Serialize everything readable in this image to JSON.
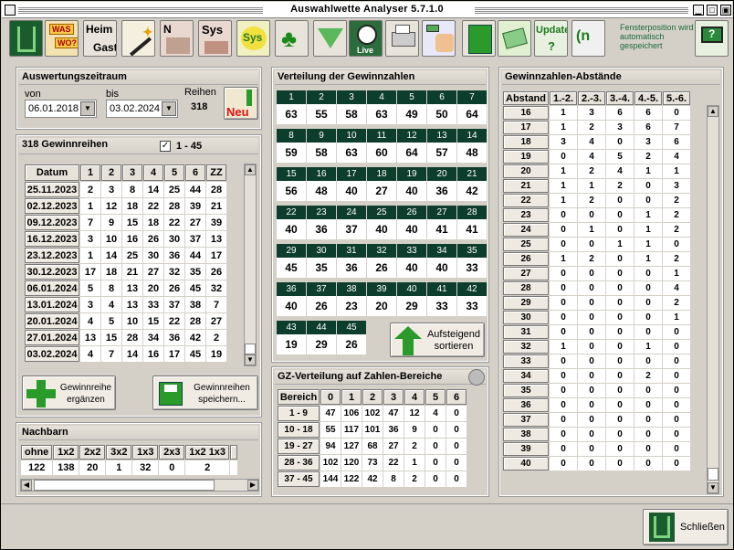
{
  "window": {
    "title": "Auswahlwette Analyser 5.7.1.0"
  },
  "toolbar": {
    "icons": [
      "app-logo-icon",
      "was-wo-icon",
      "heim-gast-icon",
      "magic-wand-icon",
      "n-chart-icon",
      "sys-icon",
      "sys-lamp-icon",
      "clover-icon",
      "funnel-icon",
      "live-ball-icon",
      "printer-icon",
      "hand-calculator-icon",
      "spreadsheet-icon",
      "tips-icon",
      "update-icon",
      "nk-icon",
      "help-computer-icon"
    ],
    "heim": "Heim",
    "gast": "Gast",
    "was": "WAS",
    "wo": "WO?",
    "n": "N",
    "sys": "Sys",
    "sys2": "Sys",
    "live": "Live",
    "update": "Update",
    "note": "Fensterposition wird automatisch gespeichert"
  },
  "zeitraum": {
    "title": "Auswertungszeitraum",
    "von_label": "von",
    "bis_label": "bis",
    "reihen_label": "Reihen",
    "von": "06.01.2018",
    "bis": "03.02.2024",
    "reihen": "318",
    "neu": "Neu"
  },
  "gewinnreihen": {
    "title": "318 Gewinnreihen",
    "filter": "1 - 45",
    "headers": [
      "Datum",
      "1",
      "2",
      "3",
      "4",
      "5",
      "6",
      "ZZ"
    ],
    "rows": [
      [
        "25.11.2023",
        "2",
        "3",
        "8",
        "14",
        "25",
        "44",
        "28"
      ],
      [
        "02.12.2023",
        "1",
        "12",
        "18",
        "22",
        "28",
        "39",
        "21"
      ],
      [
        "09.12.2023",
        "7",
        "9",
        "15",
        "18",
        "22",
        "27",
        "39"
      ],
      [
        "16.12.2023",
        "3",
        "10",
        "16",
        "26",
        "30",
        "37",
        "13"
      ],
      [
        "23.12.2023",
        "1",
        "14",
        "25",
        "30",
        "36",
        "44",
        "17"
      ],
      [
        "30.12.2023",
        "17",
        "18",
        "21",
        "27",
        "32",
        "35",
        "26"
      ],
      [
        "06.01.2024",
        "5",
        "8",
        "13",
        "20",
        "26",
        "45",
        "32"
      ],
      [
        "13.01.2024",
        "3",
        "4",
        "13",
        "33",
        "37",
        "38",
        "7"
      ],
      [
        "20.01.2024",
        "4",
        "5",
        "10",
        "15",
        "22",
        "28",
        "27"
      ],
      [
        "27.01.2024",
        "13",
        "15",
        "28",
        "34",
        "36",
        "42",
        "2"
      ],
      [
        "03.02.2024",
        "4",
        "7",
        "14",
        "16",
        "17",
        "45",
        "19"
      ]
    ],
    "add_btn": "Gewinnreihe ergänzen",
    "save_btn": "Gewinnreihen speichern..."
  },
  "nachbarn": {
    "title": "Nachbarn",
    "headers": [
      "ohne",
      "1x2",
      "2x2",
      "3x2",
      "1x3",
      "2x3",
      "1x2 1x3",
      ""
    ],
    "values": [
      "122",
      "138",
      "20",
      "1",
      "32",
      "0",
      "2",
      ""
    ]
  },
  "verteilung": {
    "title": "Verteilung der Gewinnzahlen",
    "counts": [
      "63",
      "55",
      "58",
      "63",
      "49",
      "50",
      "64",
      "59",
      "58",
      "63",
      "60",
      "64",
      "57",
      "48",
      "56",
      "48",
      "40",
      "27",
      "40",
      "36",
      "42",
      "40",
      "36",
      "37",
      "40",
      "40",
      "41",
      "41",
      "45",
      "35",
      "36",
      "26",
      "40",
      "40",
      "33",
      "40",
      "26",
      "23",
      "20",
      "29",
      "33",
      "33",
      "19",
      "29",
      "26"
    ],
    "sort_btn": "Aufsteigend sortieren"
  },
  "bereich": {
    "title": "GZ-Verteilung auf Zahlen-Bereiche",
    "headers": [
      "Bereich",
      "0",
      "1",
      "2",
      "3",
      "4",
      "5",
      "6"
    ],
    "rows": [
      [
        "1 - 9",
        "47",
        "106",
        "102",
        "47",
        "12",
        "4",
        "0"
      ],
      [
        "10 - 18",
        "55",
        "117",
        "101",
        "36",
        "9",
        "0",
        "0"
      ],
      [
        "19 - 27",
        "94",
        "127",
        "68",
        "27",
        "2",
        "0",
        "0"
      ],
      [
        "28 - 36",
        "102",
        "120",
        "73",
        "22",
        "1",
        "0",
        "0"
      ],
      [
        "37 - 45",
        "144",
        "122",
        "42",
        "8",
        "2",
        "0",
        "0"
      ]
    ]
  },
  "abstaende": {
    "title": "Gewinnzahlen-Abstände",
    "headers": [
      "Abstand",
      "1.-2.",
      "2.-3.",
      "3.-4.",
      "4.-5.",
      "5.-6."
    ],
    "rows": [
      [
        "16",
        "1",
        "3",
        "6",
        "6",
        "0"
      ],
      [
        "17",
        "1",
        "2",
        "3",
        "6",
        "7"
      ],
      [
        "18",
        "3",
        "4",
        "0",
        "3",
        "6"
      ],
      [
        "19",
        "0",
        "4",
        "5",
        "2",
        "4"
      ],
      [
        "20",
        "1",
        "2",
        "4",
        "1",
        "1"
      ],
      [
        "21",
        "1",
        "1",
        "2",
        "0",
        "3"
      ],
      [
        "22",
        "1",
        "2",
        "0",
        "0",
        "2"
      ],
      [
        "23",
        "0",
        "0",
        "0",
        "1",
        "2"
      ],
      [
        "24",
        "0",
        "1",
        "0",
        "1",
        "2"
      ],
      [
        "25",
        "0",
        "0",
        "1",
        "1",
        "0"
      ],
      [
        "26",
        "1",
        "2",
        "0",
        "1",
        "2"
      ],
      [
        "27",
        "0",
        "0",
        "0",
        "0",
        "1"
      ],
      [
        "28",
        "0",
        "0",
        "0",
        "0",
        "4"
      ],
      [
        "29",
        "0",
        "0",
        "0",
        "0",
        "2"
      ],
      [
        "30",
        "0",
        "0",
        "0",
        "0",
        "1"
      ],
      [
        "31",
        "0",
        "0",
        "0",
        "0",
        "0"
      ],
      [
        "32",
        "1",
        "0",
        "0",
        "1",
        "0"
      ],
      [
        "33",
        "0",
        "0",
        "0",
        "0",
        "0"
      ],
      [
        "34",
        "0",
        "0",
        "0",
        "2",
        "0"
      ],
      [
        "35",
        "0",
        "0",
        "0",
        "0",
        "0"
      ],
      [
        "36",
        "0",
        "0",
        "0",
        "0",
        "0"
      ],
      [
        "37",
        "0",
        "0",
        "0",
        "0",
        "0"
      ],
      [
        "38",
        "0",
        "0",
        "0",
        "0",
        "0"
      ],
      [
        "39",
        "0",
        "0",
        "0",
        "0",
        "0"
      ],
      [
        "40",
        "0",
        "0",
        "0",
        "0",
        "0"
      ]
    ]
  },
  "footer": {
    "close": "Schließen"
  }
}
